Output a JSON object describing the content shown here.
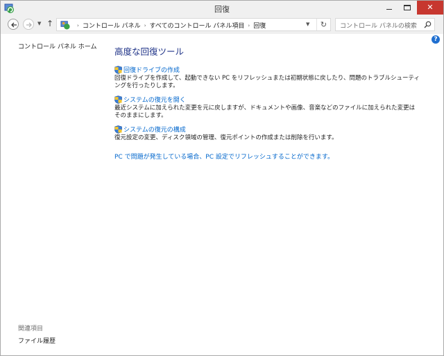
{
  "window": {
    "title": "回復",
    "minimize_label": "",
    "maximize_label": "",
    "close_label": "✕"
  },
  "nav": {
    "back_icon": "back-arrow-icon",
    "forward_icon": "forward-arrow-icon",
    "up_icon": "up-arrow-icon",
    "up_glyph": "↑",
    "dropdown_glyph": "▼",
    "breadcrumb": [
      "コントロール パネル",
      "すべてのコントロール パネル項目",
      "回復"
    ],
    "crumb_separator": "›",
    "refresh_glyph": "↻",
    "search_placeholder": "コントロール パネルの検索"
  },
  "sidebar": {
    "home_link": "コントロール パネル ホーム",
    "related_title": "関連項目",
    "related_items": [
      "ファイル履歴"
    ]
  },
  "main": {
    "heading": "高度な回復ツール",
    "tasks": [
      {
        "link": "回復ドライブの作成",
        "description": "回復ドライブを作成して、起動できない PC をリフレッシュまたは初期状態に戻したり、問題のトラブルシューティングを行ったりします。"
      },
      {
        "link": "システムの復元を開く",
        "description": "最近システムに加えられた変更を元に戻しますが、ドキュメントや画像、音楽などのファイルに加えられた変更はそのままにします。"
      },
      {
        "link": "システムの復元の構成",
        "description": "復元設定の変更、ディスク領域の管理、復元ポイントの作成または削除を行います。"
      }
    ],
    "pc_settings_link": "PC で問題が発生している場合、PC 設定でリフレッシュすることができます。",
    "help_glyph": "?"
  },
  "colors": {
    "link": "#0066cc",
    "heading": "#1e3287",
    "close_button": "#c7372f",
    "help": "#1f6fd0"
  }
}
